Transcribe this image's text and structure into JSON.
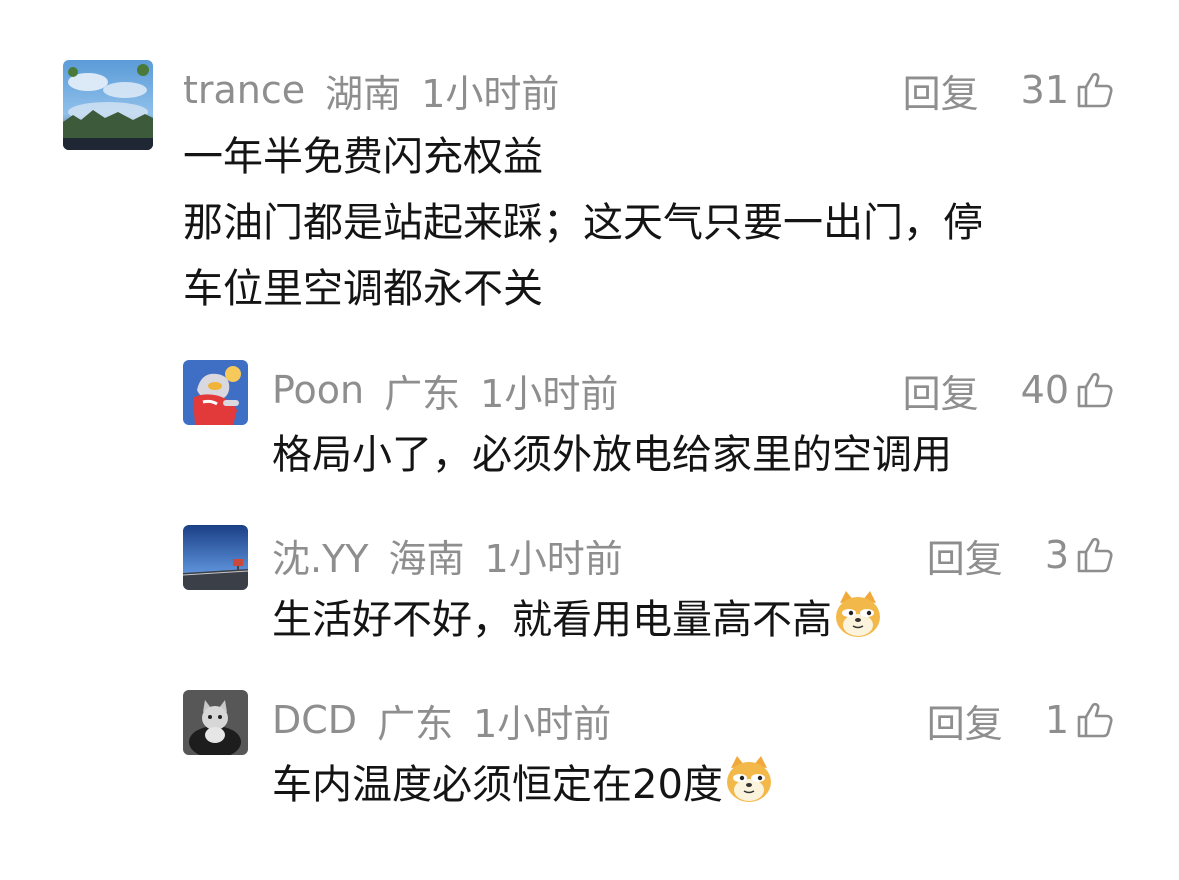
{
  "comments": [
    {
      "user": "trance",
      "region": "湖南",
      "time": "1小时前",
      "reply_label": "回复",
      "likes": "31",
      "lines": [
        "一年半免费闪充权益",
        "那油门都是站起来踩；这天气只要一出门，停",
        "车位里空调都永不关"
      ],
      "avatar_icon": "landscape-avatar"
    },
    {
      "user": "Poon",
      "region": "广东",
      "time": "1小时前",
      "reply_label": "回复",
      "likes": "40",
      "text": "格局小了，必须外放电给家里的空调用",
      "avatar_icon": "ultraman-avatar"
    },
    {
      "user": "沈.YY",
      "region": "海南",
      "time": "1小时前",
      "reply_label": "回复",
      "likes": "3",
      "text": "生活好不好，就看用电量高不高",
      "emoji": "doge-emoji",
      "avatar_icon": "road-avatar"
    },
    {
      "user": "DCD",
      "region": "广东",
      "time": "1小时前",
      "reply_label": "回复",
      "likes": "1",
      "text": "车内温度必须恒定在20度",
      "emoji": "doge-emoji",
      "avatar_icon": "cat-avatar"
    }
  ],
  "colors": {
    "meta": "#8e8e8e",
    "text": "#141414",
    "background": "#ffffff"
  }
}
